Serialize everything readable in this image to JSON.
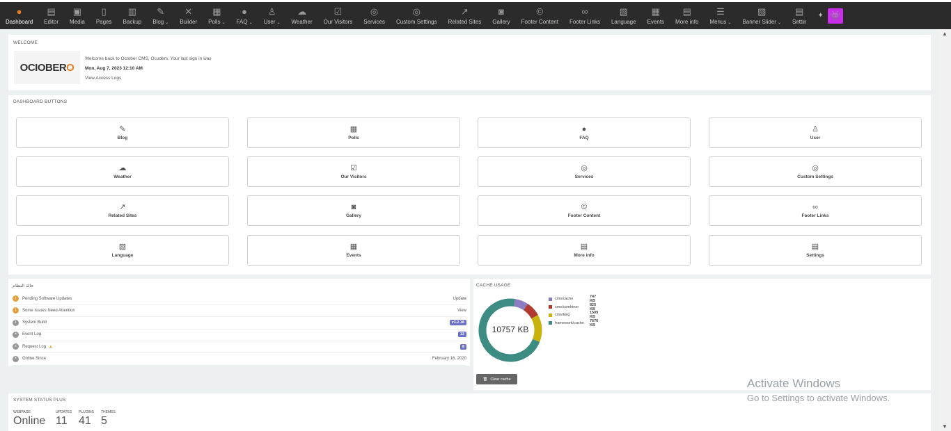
{
  "topnav": [
    {
      "label": "Dashboard",
      "icon": "october-logo-icon",
      "glyph": "●",
      "active": true,
      "caret": false
    },
    {
      "label": "Editor",
      "icon": "editor-icon",
      "glyph": "▤",
      "caret": false
    },
    {
      "label": "Media",
      "icon": "media-icon",
      "glyph": "▣",
      "caret": false
    },
    {
      "label": "Pages",
      "icon": "pages-icon",
      "glyph": "▯",
      "caret": false
    },
    {
      "label": "Backup",
      "icon": "backup-icon",
      "glyph": "▥",
      "caret": false
    },
    {
      "label": "Blog",
      "icon": "blog-icon",
      "glyph": "✎",
      "caret": true
    },
    {
      "label": "Builder",
      "icon": "builder-icon",
      "glyph": "✕",
      "caret": false
    },
    {
      "label": "Polls",
      "icon": "polls-icon",
      "glyph": "▦",
      "caret": true
    },
    {
      "label": "FAQ",
      "icon": "faq-icon",
      "glyph": "●",
      "caret": true
    },
    {
      "label": "User",
      "icon": "user-icon",
      "glyph": "♙",
      "caret": true
    },
    {
      "label": "Weather",
      "icon": "weather-icon",
      "glyph": "☁",
      "caret": false
    },
    {
      "label": "Our Visitors",
      "icon": "visitors-icon",
      "glyph": "☑",
      "caret": false
    },
    {
      "label": "Services",
      "icon": "services-icon",
      "glyph": "◎",
      "caret": false
    },
    {
      "label": "Custom Settings",
      "icon": "custom-settings-icon",
      "glyph": "◎",
      "caret": false
    },
    {
      "label": "Related Sites",
      "icon": "related-sites-icon",
      "glyph": "↗",
      "caret": false
    },
    {
      "label": "Gallery",
      "icon": "gallery-icon",
      "glyph": "◙",
      "caret": false
    },
    {
      "label": "Footer Content",
      "icon": "footer-content-icon",
      "glyph": "©",
      "caret": false
    },
    {
      "label": "Footer Links",
      "icon": "footer-links-icon",
      "glyph": "∞",
      "caret": false
    },
    {
      "label": "Language",
      "icon": "language-icon",
      "glyph": "▧",
      "caret": false
    },
    {
      "label": "Events",
      "icon": "events-icon",
      "glyph": "▦",
      "caret": false
    },
    {
      "label": "More info",
      "icon": "more-info-icon",
      "glyph": "▤",
      "caret": false
    },
    {
      "label": "Menus",
      "icon": "menus-icon",
      "glyph": "☰",
      "caret": true
    },
    {
      "label": "Banner Slider",
      "icon": "banner-slider-icon",
      "glyph": "▨",
      "caret": true
    },
    {
      "label": "Settin",
      "icon": "settings-icon",
      "glyph": "▤",
      "caret": false
    }
  ],
  "welcome": {
    "title": "WELCOME",
    "logo_text": "OCIOBER",
    "logo_mark": "O",
    "message": "Welcome back to October CMS, Ocuders. Your last sign in was",
    "last_login": "Mon, Aug 7, 2023 12:10 AM",
    "access_logs": "View Access Logs"
  },
  "dashboard_buttons": {
    "title": "DASHBOARD BUTTONS",
    "items": [
      {
        "label": "Blog",
        "icon": "blog-icon",
        "glyph": "✎"
      },
      {
        "label": "Polls",
        "icon": "polls-icon",
        "glyph": "▦"
      },
      {
        "label": "FAQ",
        "icon": "faq-icon",
        "glyph": "●"
      },
      {
        "label": "User",
        "icon": "user-icon",
        "glyph": "♙"
      },
      {
        "label": "Weather",
        "icon": "weather-icon",
        "glyph": "☁"
      },
      {
        "label": "Our Visitors",
        "icon": "visitors-icon",
        "glyph": "☑"
      },
      {
        "label": "Services",
        "icon": "services-icon",
        "glyph": "◎"
      },
      {
        "label": "Custom Settings",
        "icon": "custom-settings-icon",
        "glyph": "◎"
      },
      {
        "label": "Related Sites",
        "icon": "related-sites-icon",
        "glyph": "↗"
      },
      {
        "label": "Gallery",
        "icon": "gallery-icon",
        "glyph": "◙"
      },
      {
        "label": "Footer Content",
        "icon": "footer-content-icon",
        "glyph": "©"
      },
      {
        "label": "Footer Links",
        "icon": "footer-links-icon",
        "glyph": "∞"
      },
      {
        "label": "Language",
        "icon": "language-icon",
        "glyph": "▧"
      },
      {
        "label": "Events",
        "icon": "events-icon",
        "glyph": "▦"
      },
      {
        "label": "More info",
        "icon": "more-info-icon",
        "glyph": "▤"
      },
      {
        "label": "Settings",
        "icon": "settings-icon",
        "glyph": "▤"
      }
    ]
  },
  "system_status": {
    "title": "حالة النظام",
    "rows": [
      {
        "label": "Pending Software Updates",
        "icon": "warning-icon",
        "color": "#e2a03f",
        "value": "Update",
        "type": "text"
      },
      {
        "label": "Some Issues Need Attention",
        "icon": "warning-icon",
        "color": "#e2a03f",
        "value": "View",
        "type": "text"
      },
      {
        "label": "System Build",
        "icon": "info-icon",
        "color": "#999999",
        "value": "v3.2.18",
        "type": "badge"
      },
      {
        "label": "Event Log",
        "icon": "event-log-icon",
        "color": "#999999",
        "value": "13",
        "type": "badge"
      },
      {
        "label": "Request Log",
        "icon": "request-log-icon",
        "color": "#999999",
        "value": "8",
        "type": "badge",
        "flag": "▲"
      },
      {
        "label": "Online Since",
        "icon": "calendar-icon",
        "color": "#999999",
        "value": "February 16, 2020",
        "type": "text"
      }
    ]
  },
  "cache_usage": {
    "title": "CACHE USAGE",
    "total": "10757 KB",
    "clear_label": "Clear cache",
    "chart_data": {
      "type": "pie",
      "categories": [
        "cms/cache",
        "cms/combiner",
        "cms/twig",
        "framework/cache"
      ],
      "values": [
        747,
        825,
        1509,
        7676
      ],
      "value_labels": [
        "747 KB",
        "825 KB",
        "1509 KB",
        "7676 KB"
      ],
      "colors": [
        "#8e7cc3",
        "#b03a2e",
        "#c9b20c",
        "#3c8c84"
      ]
    }
  },
  "system_status_plus": {
    "title": "SYSTEM STATUS PLUS",
    "stats": [
      {
        "label": "WEBPAGE",
        "value": "Online"
      },
      {
        "label": "UPDATES",
        "value": "11"
      },
      {
        "label": "PLUGINS",
        "value": "41"
      },
      {
        "label": "THEMES",
        "value": "5"
      }
    ]
  },
  "activate_windows": {
    "line1": "Activate Windows",
    "line2": "Go to Settings to activate Windows."
  },
  "header_right": {
    "diamond": "✦",
    "avatar": "👾"
  }
}
